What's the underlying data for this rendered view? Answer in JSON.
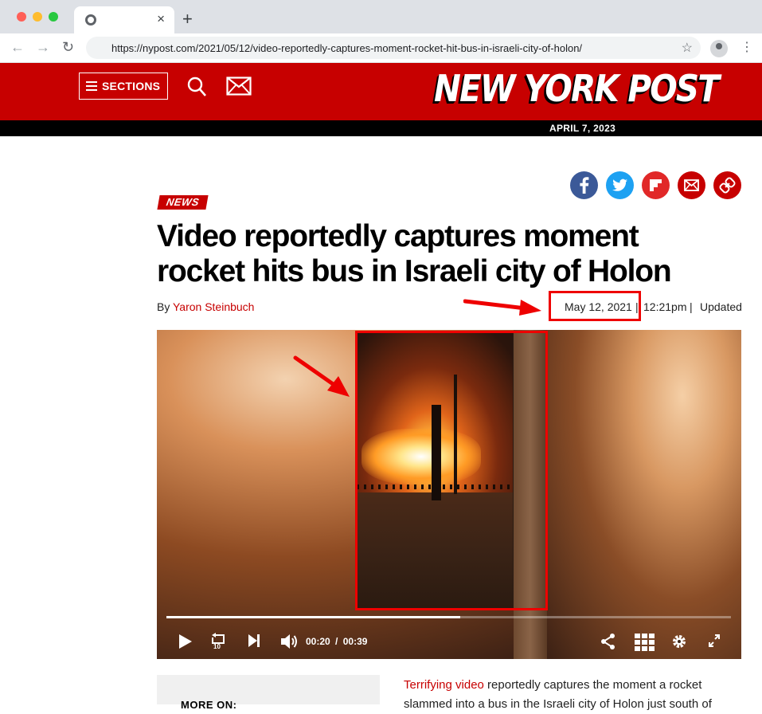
{
  "browser": {
    "tab_close": "×",
    "new_tab": "+",
    "url": "https://nypost.com/2021/05/12/video-reportedly-captures-moment-rocket-hit-bus-in-israeli-city-of-holon/",
    "star": "☆",
    "menu": "⋮",
    "back": "←",
    "forward": "→",
    "reload": "↻"
  },
  "masthead": {
    "sections_label": "SECTIONS",
    "logo_text": "NEW YORK POST",
    "date": "APRIL 7, 2023"
  },
  "colors": {
    "brand_red": "#c70000",
    "annotation_red": "#ee0000"
  },
  "article": {
    "category": "NEWS",
    "headline": "Video reportedly captures moment rocket hits bus in Israeli city of Holon",
    "byline_prefix": "By",
    "author": "Yaron Steinbuch",
    "date": "May 12, 2021",
    "separator1": "|",
    "time": "12:21pm",
    "separator2": "|",
    "updated": "Updated"
  },
  "video": {
    "current_time": "00:20",
    "time_separator": "/",
    "duration": "00:39",
    "progress_fraction": 0.52,
    "replay_label": "10"
  },
  "sidebar": {
    "more_on": "MORE ON:"
  },
  "body": {
    "link_text": "Terrifying video",
    "text": " reportedly captures the moment a rocket slammed into a bus in the Israeli city of Holon just south of"
  }
}
